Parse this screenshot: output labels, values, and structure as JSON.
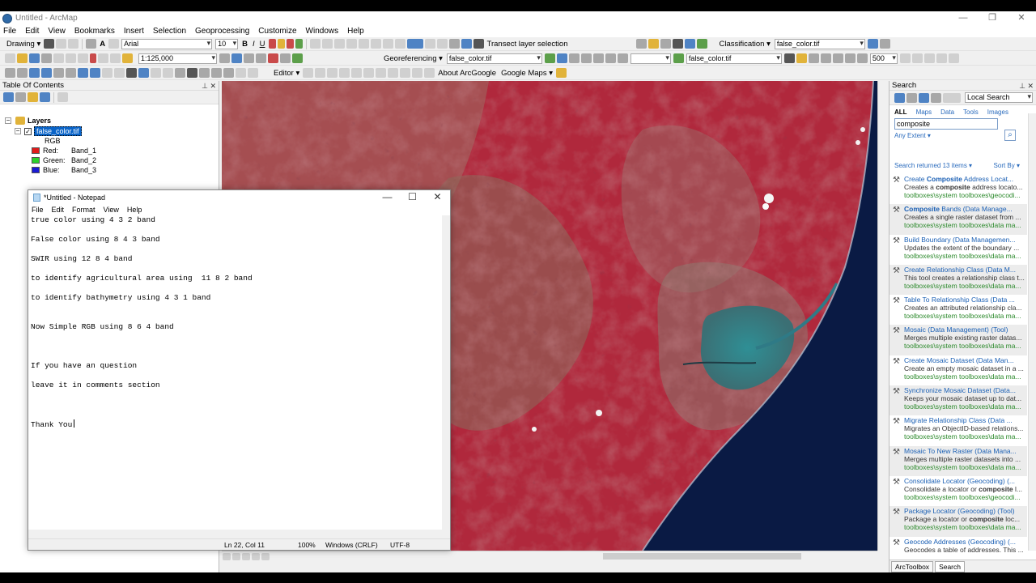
{
  "window": {
    "title": "Untitled - ArcMap",
    "controls": [
      "—",
      "❐",
      "✕"
    ]
  },
  "menu": [
    "File",
    "Edit",
    "View",
    "Bookmarks",
    "Insert",
    "Selection",
    "Geoprocessing",
    "Customize",
    "Windows",
    "Help"
  ],
  "toolbar1": {
    "drawing": "Drawing ▾",
    "font": "Arial",
    "font_size": "10",
    "bold": "B",
    "italic": "I",
    "underline": "U",
    "text_A": "A",
    "transect": "Transect layer selection",
    "classification": "Classification ▾",
    "layer_combo": "false_color.tif"
  },
  "toolbar2": {
    "scale": "1:125,000",
    "georeferencing": "Georeferencing ▾",
    "geo_layer": "false_color.tif",
    "layer2": "false_color.tif",
    "value": "500"
  },
  "toolbar3": {
    "editor": "Editor ▾",
    "about": "About ArcGoogle",
    "google_maps": "Google Maps ▾"
  },
  "toc": {
    "title": "Table Of Contents",
    "layers": "Layers",
    "layer_name": "false_color.tif",
    "rgb": "RGB",
    "bands": [
      {
        "label": "Red:",
        "band": "Band_1",
        "color": "#e01b1b"
      },
      {
        "label": "Green:",
        "band": "Band_2",
        "color": "#2bd12b"
      },
      {
        "label": "Blue:",
        "band": "Band_3",
        "color": "#1a1ad4"
      }
    ]
  },
  "notepad": {
    "title": "*Untitled - Notepad",
    "menu": [
      "File",
      "Edit",
      "Format",
      "View",
      "Help"
    ],
    "lines": [
      "true color using 4 3 2 band",
      "",
      "False color using 8 4 3 band",
      "",
      "SWIR using 12 8 4 band",
      "",
      "to identify agricultural area using  11 8 2 band",
      "",
      "to identify bathymetry using 4 3 1 band",
      "",
      "",
      "Now Simple RGB using 8 6 4 band",
      "",
      "",
      "",
      "If you have an question",
      "",
      "leave it in comments section",
      "",
      "",
      "",
      "Thank You"
    ],
    "status": {
      "position": "Ln 22, Col 11",
      "zoom": "100%",
      "eol": "Windows (CRLF)",
      "encoding": "UTF-8"
    }
  },
  "search": {
    "title": "Search",
    "scope": "Local Search",
    "tabs": [
      "ALL",
      "Maps",
      "Data",
      "Tools",
      "Images"
    ],
    "query": "composite",
    "extent": "Any Extent ▾",
    "returned": "Search returned 13 items ▾",
    "sort": "Sort By ▾",
    "results": [
      {
        "title": "Create Composite Address Locat...",
        "desc": "Creates a composite address locato...",
        "path": "toolboxes\\system toolboxes\\geocodi..."
      },
      {
        "title": "Composite Bands (Data Manage...",
        "desc": "Creates a single raster dataset from ...",
        "path": "toolboxes\\system toolboxes\\data ma..."
      },
      {
        "title": "Build Boundary (Data Managemen...",
        "desc": "Updates the extent of the boundary ...",
        "path": "toolboxes\\system toolboxes\\data ma..."
      },
      {
        "title": "Create Relationship Class (Data M...",
        "desc": "This tool creates a relationship class t...",
        "path": "toolboxes\\system toolboxes\\data ma..."
      },
      {
        "title": "Table To Relationship Class (Data ...",
        "desc": "Creates an attributed relationship cla...",
        "path": "toolboxes\\system toolboxes\\data ma..."
      },
      {
        "title": "Mosaic (Data Management) (Tool)",
        "desc": "Merges multiple existing raster datas...",
        "path": "toolboxes\\system toolboxes\\data ma..."
      },
      {
        "title": "Create Mosaic Dataset (Data Man...",
        "desc": "Create an empty mosaic dataset in a ...",
        "path": "toolboxes\\system toolboxes\\data ma..."
      },
      {
        "title": "Synchronize Mosaic Dataset (Data...",
        "desc": "Keeps your mosaic dataset up to dat...",
        "path": "toolboxes\\system toolboxes\\data ma..."
      },
      {
        "title": "Migrate Relationship Class (Data ...",
        "desc": "Migrates an ObjectID-based relations...",
        "path": "toolboxes\\system toolboxes\\data ma..."
      },
      {
        "title": "Mosaic To New Raster (Data Mana...",
        "desc": "Merges multiple raster datasets into ...",
        "path": "toolboxes\\system toolboxes\\data ma..."
      },
      {
        "title": "Consolidate Locator (Geocoding) (...",
        "desc": "Consolidate a locator or composite l...",
        "path": "toolboxes\\system toolboxes\\geocodi..."
      },
      {
        "title": "Package Locator (Geocoding) (Tool)",
        "desc": "Package a locator or composite loc...",
        "path": "toolboxes\\system toolboxes\\data ma..."
      },
      {
        "title": "Geocode Addresses (Geocoding) (...",
        "desc": "Geocodes a table of addresses. This ...",
        "path": ""
      }
    ],
    "bottom_tabs": [
      "ArcToolbox",
      "Search"
    ]
  }
}
